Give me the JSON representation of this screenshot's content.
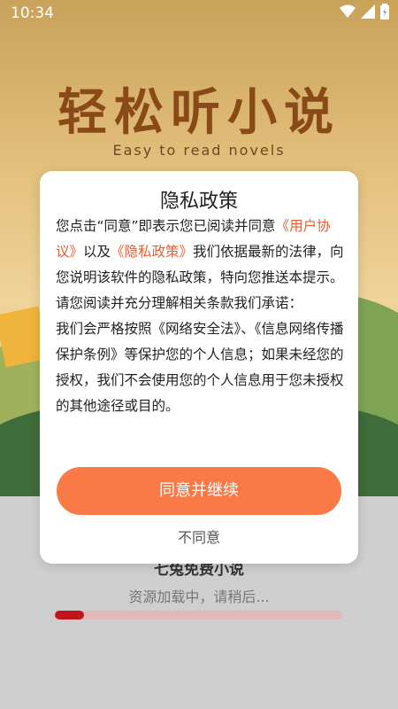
{
  "status": {
    "time": "10:34"
  },
  "splash": {
    "title_cn": "轻松听小说",
    "title_en": "Easy to read novels",
    "under_text": "七兔免费小说",
    "loading_text": "资源加载中，请稍后...",
    "progress": 0.1
  },
  "dialog": {
    "title": "隐私政策",
    "p1_a": "您点击“同意”即表示您已阅读并同意",
    "link_user": "《用户协议》",
    "p1_b": "以及",
    "link_privacy": "《隐私政策》",
    "p1_c": "我们依据最新的法律，向您说明该软件的隐私政策，特向您推送本提示。请您阅读并充分理解相关条款我们承诺：",
    "p2": "我们会严格按照《网络安全法》、《信息网络传播保护条例》等保护您的个人信息；如果未经您的授权，我们不会使用您的个人信息用于您未授权的其他途径或目的。",
    "agree_label": "同意并继续",
    "disagree_label": "不同意"
  }
}
